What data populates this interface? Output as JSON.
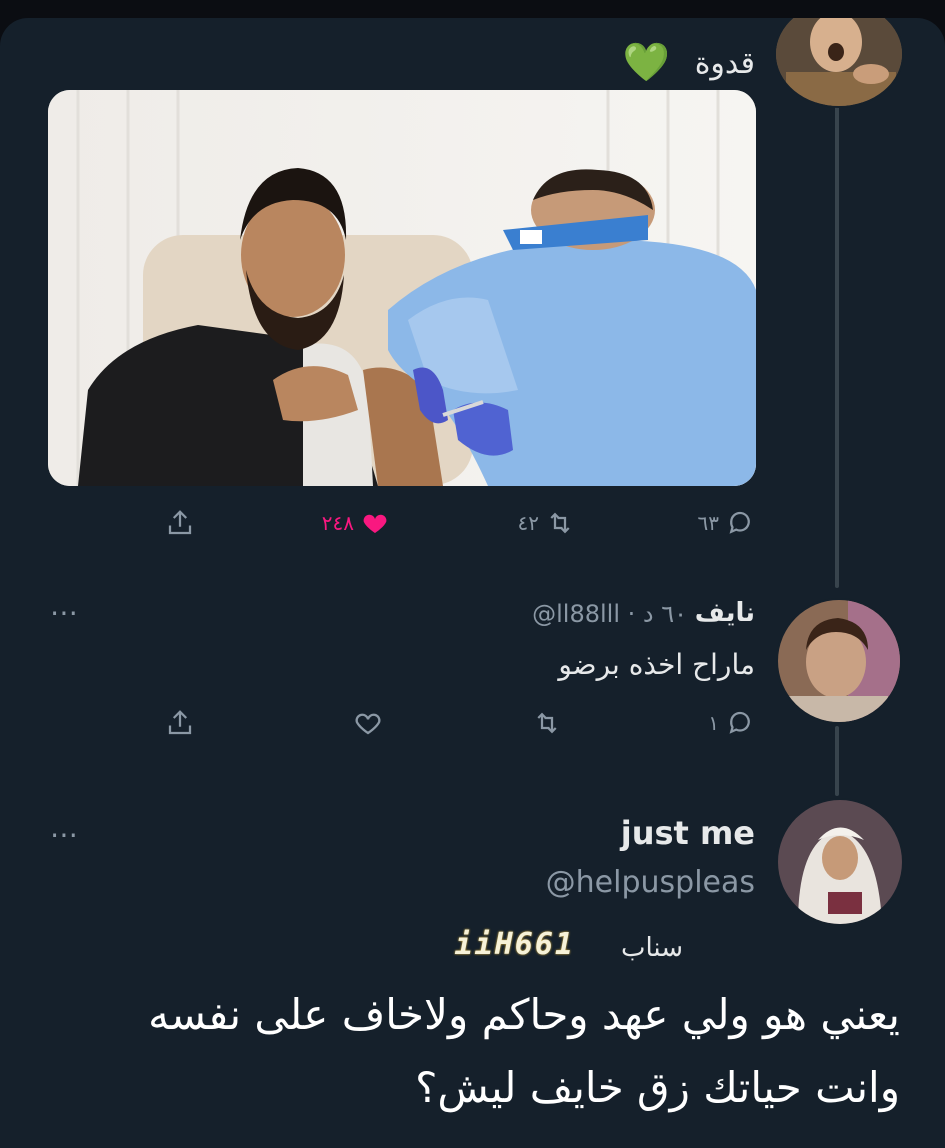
{
  "tweet": {
    "text": "قدوة",
    "emoji": "💚",
    "replies_count": "٦٣",
    "retweets_count": "٤٢",
    "likes_count": "٢٤٨"
  },
  "reply1": {
    "name": "نايف",
    "handle_time": "@ll88lll · ٦٠ د",
    "text": "ماراح اخذه برضو",
    "replies_count": "١"
  },
  "reply2": {
    "name": "just me",
    "handle": "@helpuspleas",
    "snap_label": "سناب",
    "snap_code": "iiH661",
    "text_line1": "يعني هو ولي عهد وحاكم ولاخاف على نفسه",
    "text_line2": "وانت حياتك زق خايف ليش؟"
  },
  "icons": {
    "more": "⋯"
  },
  "colors": {
    "background": "#15202b",
    "like": "#f91880",
    "muted": "#8b98a5"
  }
}
